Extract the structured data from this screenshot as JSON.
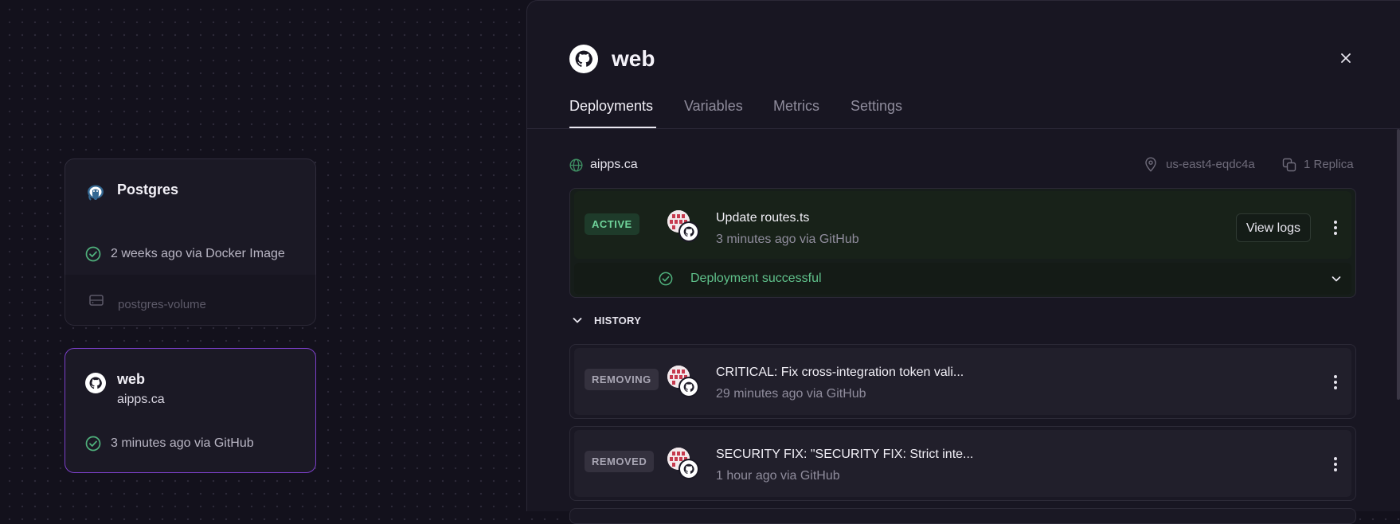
{
  "canvas": {
    "postgres": {
      "title": "Postgres",
      "status": "2 weeks ago via Docker Image",
      "volume": "postgres-volume"
    },
    "web": {
      "title": "web",
      "domain": "aipps.ca",
      "status": "3 minutes ago via GitHub"
    }
  },
  "panel": {
    "title": "web",
    "tabs": [
      "Deployments",
      "Variables",
      "Metrics",
      "Settings"
    ],
    "active_tab": "Deployments",
    "domain": "aipps.ca",
    "region": "us-east4-eqdc4a",
    "replicas": "1 Replica",
    "active_deployment": {
      "badge": "ACTIVE",
      "title": "Update routes.ts",
      "subtitle": "3 minutes ago via GitHub",
      "view_logs_label": "View logs",
      "status": "Deployment successful"
    },
    "history_label": "HISTORY",
    "history": [
      {
        "badge": "REMOVING",
        "title": "CRITICAL: Fix cross-integration token vali...",
        "subtitle": "29 minutes ago via GitHub"
      },
      {
        "badge": "REMOVED",
        "title": "SECURITY FIX: \"SECURITY FIX: Strict inte...",
        "subtitle": "1 hour ago via GitHub"
      }
    ]
  },
  "colors": {
    "background": "#13111c",
    "panel": "#181622",
    "success_green": "#4fb07c",
    "web_card_border": "#7b3fc9",
    "active_badge_bg": "#1e3b2a"
  }
}
